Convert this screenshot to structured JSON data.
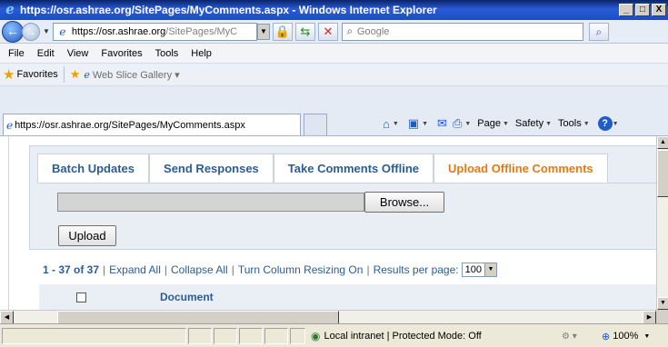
{
  "window": {
    "title": "https://osr.ashrae.org/SitePages/MyComments.aspx - Windows Internet Explorer",
    "minimize": "_",
    "maximize": "□",
    "close": "X"
  },
  "address": {
    "url_host": "https://osr.ashrae.org",
    "url_path": "/SitePages/MyC",
    "search_placeholder": "Google"
  },
  "menu": {
    "items": [
      "File",
      "Edit",
      "View",
      "Favorites",
      "Tools",
      "Help"
    ]
  },
  "favorites": {
    "label": "Favorites",
    "web_slice": "Web Slice Gallery"
  },
  "tab": {
    "title": "https://osr.ashrae.org/SitePages/MyComments.aspx"
  },
  "commands": {
    "page": "Page",
    "safety": "Safety",
    "tools": "Tools"
  },
  "page": {
    "tabs": [
      "Batch Updates",
      "Send Responses",
      "Take Comments Offline",
      "Upload Offline Comments"
    ],
    "active_tab": "Upload Offline Comments",
    "browse_label": "Browse...",
    "upload_label": "Upload",
    "results": {
      "count": "1 - 37 of 37",
      "expand_all": "Expand All",
      "collapse_all": "Collapse All",
      "column_resizing": "Turn Column Resizing On",
      "per_page_label": "Results per page:",
      "per_page_value": "100",
      "separator": "|"
    },
    "table": {
      "document_header": "Document"
    }
  },
  "status": {
    "zone": "Local intranet | Protected Mode: Off",
    "zoom": "100%"
  },
  "colors": {
    "link": "#2b5d93",
    "active_tab": "#e07b14",
    "titlebar": "#0a246a"
  }
}
